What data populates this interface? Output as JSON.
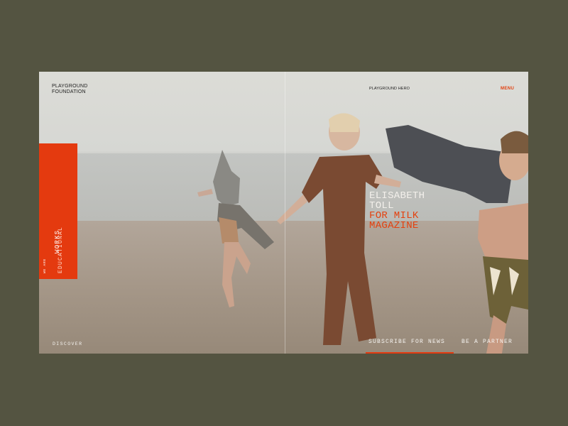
{
  "header": {
    "brand_line1": "PLAYGROUND",
    "brand_line2": "FOUNDATION",
    "center_label": "PLAYGROUND HERO",
    "menu_label": "MENU"
  },
  "side_panel": {
    "works_label": "WORKS",
    "we_are_label": "WE ARE",
    "educational_label": "EDUCATIONAL"
  },
  "headline": {
    "line1": "ELISABETH",
    "line2": "TOLL",
    "line3": "FOR MILK",
    "line4": "MAGAZINE"
  },
  "footer": {
    "discover_label": "DISCOVER",
    "subscribe_label": "SUBSCRIBE FOR NEWS",
    "partner_label": "BE A PARTNER"
  },
  "colors": {
    "accent": "#e43a0f",
    "background": "#545441"
  }
}
